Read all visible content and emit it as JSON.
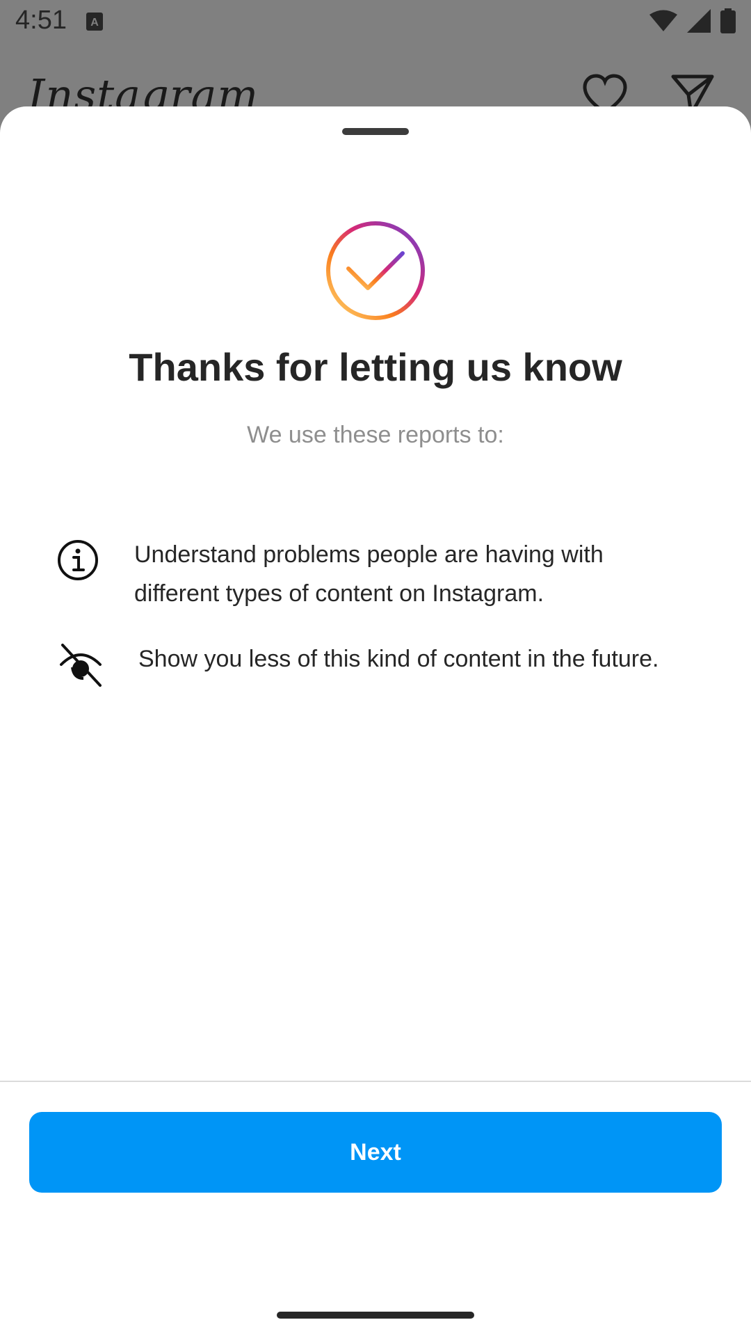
{
  "status_bar": {
    "time": "4:51"
  },
  "background_app": {
    "logo_text": "Instagram"
  },
  "sheet": {
    "title": "Thanks for letting us know",
    "subtitle": "We use these reports to:",
    "reasons": [
      {
        "icon": "info-icon",
        "text": "Understand problems people are having with different types of content on Instagram."
      },
      {
        "icon": "eye-off-icon",
        "text": "Show you less of this kind of content in the future."
      }
    ],
    "next_label": "Next"
  },
  "colors": {
    "primary_button": "#0095f6",
    "title_text": "#262626",
    "subtitle_text": "#8e8e8e",
    "scrim": "#808080"
  }
}
